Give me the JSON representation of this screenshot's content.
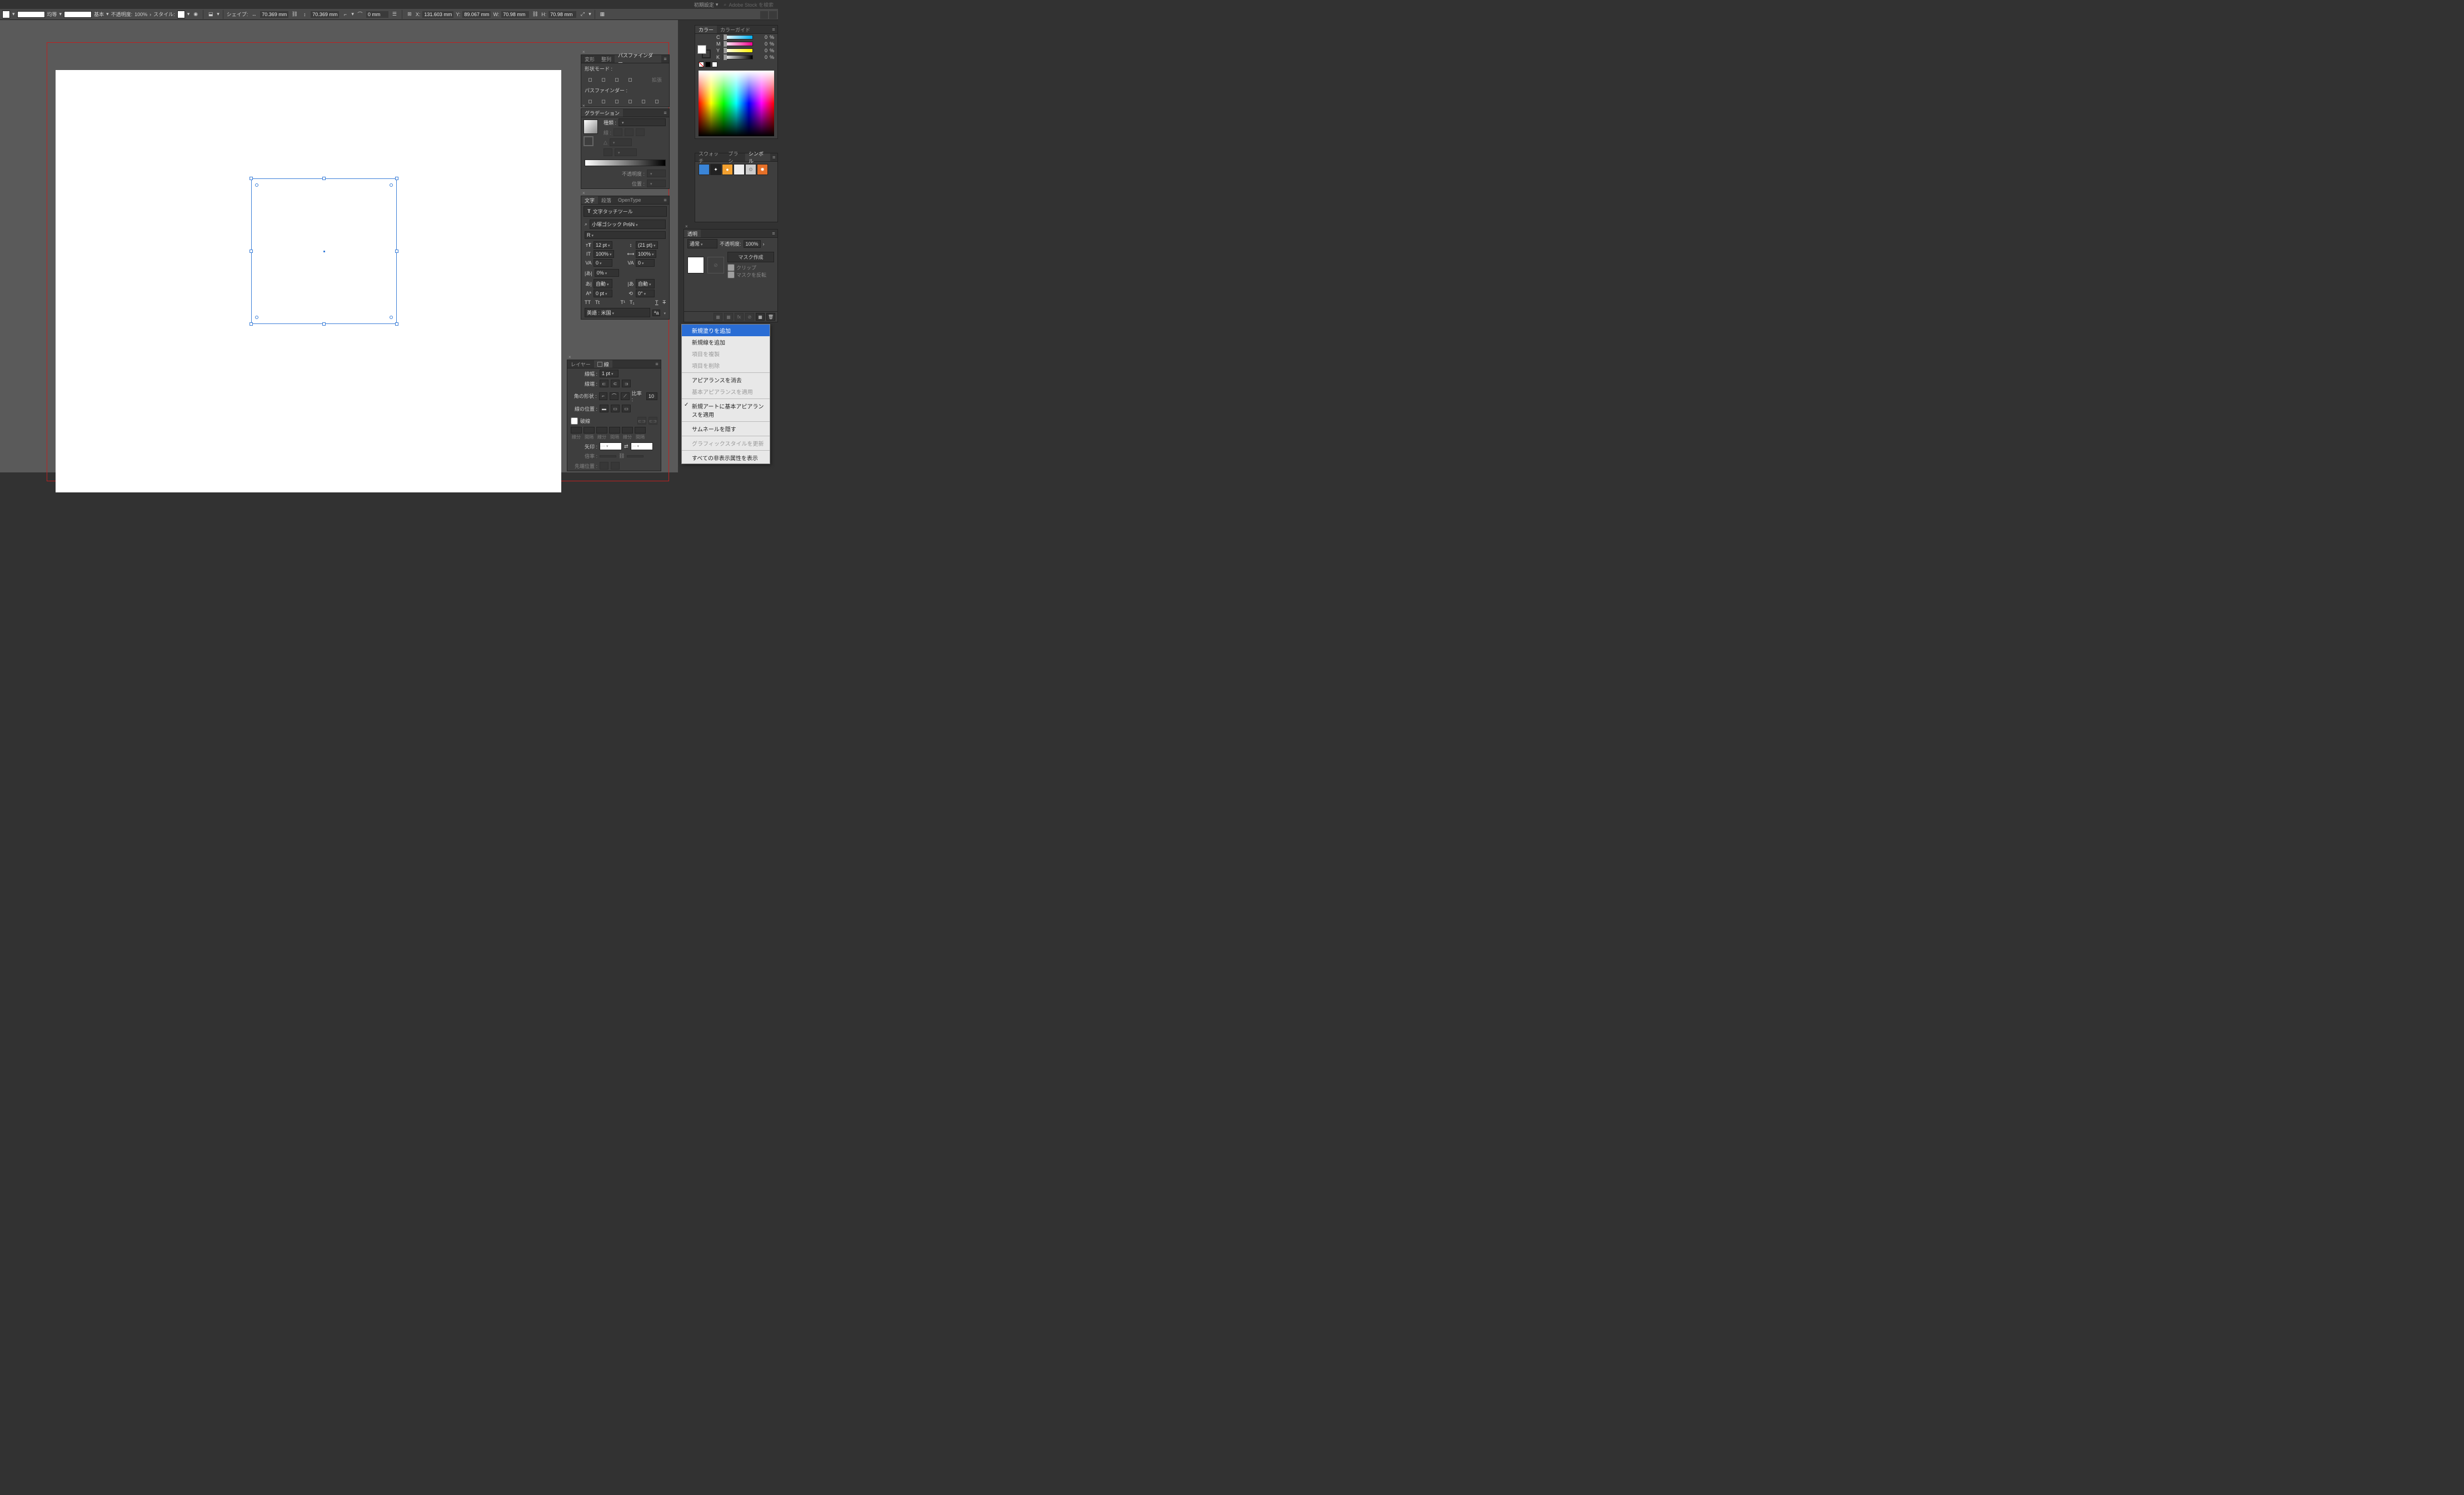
{
  "topbar": {
    "preset": "初期設定",
    "search_placeholder": "Adobe Stock を検索"
  },
  "controlbar": {
    "stroke_profile": "均等",
    "brush": "基本",
    "opacity_label": "不透明度:",
    "opacity_value": "100%",
    "style_label": "スタイル:",
    "shape_label": "シェイプ:",
    "shape_w": "70.369 mm",
    "shape_h": "70.369 mm",
    "corner": "0 mm",
    "x_label": "X:",
    "x_value": "131.603 mm",
    "y_label": "Y:",
    "y_value": "89.067 mm",
    "w_label": "W:",
    "w_value": "70.98 mm",
    "h_label": "H:",
    "h_value": "70.98 mm"
  },
  "pathfinder": {
    "tab_transform": "変形",
    "tab_align": "整列",
    "tab_pathfinder": "パスファインダー",
    "shape_modes": "形状モード :",
    "expand": "拡張",
    "pf_label": "パスファインダー :"
  },
  "gradient": {
    "tab": "グラデーション",
    "type_label": "種類 :",
    "line_label": "線 :",
    "angle_sym": "△",
    "opacity_label": "不透明度 :",
    "position_label": "位置 :"
  },
  "character": {
    "tab_char": "文字",
    "tab_para": "段落",
    "tab_ot": "OpenType",
    "touch_tool": "文字タッチツール",
    "font": "小塚ゴシック Pr6N",
    "weight": "R",
    "size": "12 pt",
    "leading": "(21 pt)",
    "hscale": "100%",
    "vscale": "100%",
    "kerning": "0",
    "tracking": "0",
    "tsume": "0%",
    "otf": "自動",
    "aki_before": "自動",
    "baseline": "0 pt",
    "rotation": "0°",
    "lang_label": "英語 : 米国"
  },
  "layer_stroke": {
    "tab_layer": "レイヤー",
    "tab_stroke": "線",
    "weight_label": "線幅 :",
    "weight": "1 pt",
    "cap_label": "線端 :",
    "corner_label": "角の形状 :",
    "limit_label": "比率 :",
    "limit": "10",
    "align_label": "線の位置 :",
    "dashed": "破線",
    "dash_labels": [
      "線分",
      "間隔",
      "線分",
      "間隔",
      "線分",
      "間隔"
    ],
    "arrow_label": "矢印 :",
    "scale_label": "倍率 :",
    "tip_align_label": "先端位置 :"
  },
  "color": {
    "tab_color": "カラー",
    "tab_guide": "カラーガイド",
    "cmyk": [
      {
        "label": "C",
        "value": "0",
        "pct": "%",
        "grad": "linear-gradient(to right,#fff,#00aeef)"
      },
      {
        "label": "M",
        "value": "0",
        "pct": "%",
        "grad": "linear-gradient(to right,#fff,#ec008c)"
      },
      {
        "label": "Y",
        "value": "0",
        "pct": "%",
        "grad": "linear-gradient(to right,#fff,#fff200)"
      },
      {
        "label": "K",
        "value": "0",
        "pct": "%",
        "grad": "linear-gradient(to right,#fff,#000)"
      }
    ]
  },
  "symbols": {
    "tab_swatch": "スウォッチ",
    "tab_brush": "ブラシ",
    "tab_symbol": "シンボル",
    "items": [
      {
        "bg": "#3a85d8"
      },
      {
        "bg": "#222"
      },
      {
        "bg": "#f2a030"
      },
      {
        "bg": "#eee"
      },
      {
        "bg": "#ccc"
      },
      {
        "bg": "#e57028"
      }
    ]
  },
  "transparency": {
    "tab": "透明",
    "mode": "通常",
    "opacity_label": "不透明度:",
    "opacity": "100%",
    "make_mask": "マスク作成",
    "clip": "クリップ",
    "invert": "マスクを反転"
  },
  "context_menu": {
    "items": [
      {
        "label": "新規塗りを追加",
        "selected": true
      },
      {
        "label": "新規線を追加"
      },
      {
        "label": "項目を複製",
        "disabled": true
      },
      {
        "label": "項目を削除",
        "disabled": true
      },
      {
        "sep": true
      },
      {
        "label": "アピアランスを消去"
      },
      {
        "label": "基本アピアランスを適用",
        "disabled": true
      },
      {
        "sep": true
      },
      {
        "label": "新規アートに基本アピアランスを適用",
        "checked": true
      },
      {
        "sep": true
      },
      {
        "label": "サムネールを隠す"
      },
      {
        "sep": true
      },
      {
        "label": "グラフィックスタイルを更新",
        "disabled": true
      },
      {
        "sep": true
      },
      {
        "label": "すべての非表示属性を表示"
      }
    ]
  }
}
